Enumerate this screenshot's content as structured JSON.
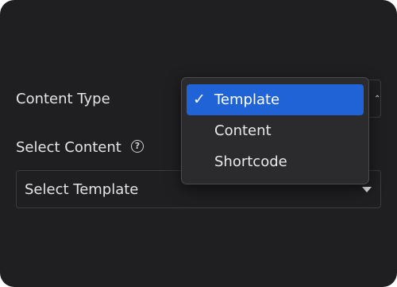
{
  "content_type": {
    "label": "Content Type",
    "options": [
      {
        "label": "Template",
        "selected": true
      },
      {
        "label": "Content",
        "selected": false
      },
      {
        "label": "Shortcode",
        "selected": false
      }
    ],
    "check_glyph": "✓"
  },
  "select_content": {
    "label": "Select Content",
    "help_icon": "help-circle-icon",
    "value": "Select Template"
  },
  "colors": {
    "panel_background": "#1f1f22",
    "selected_highlight": "#1f63d6",
    "menu_background": "#2b2b2e"
  }
}
